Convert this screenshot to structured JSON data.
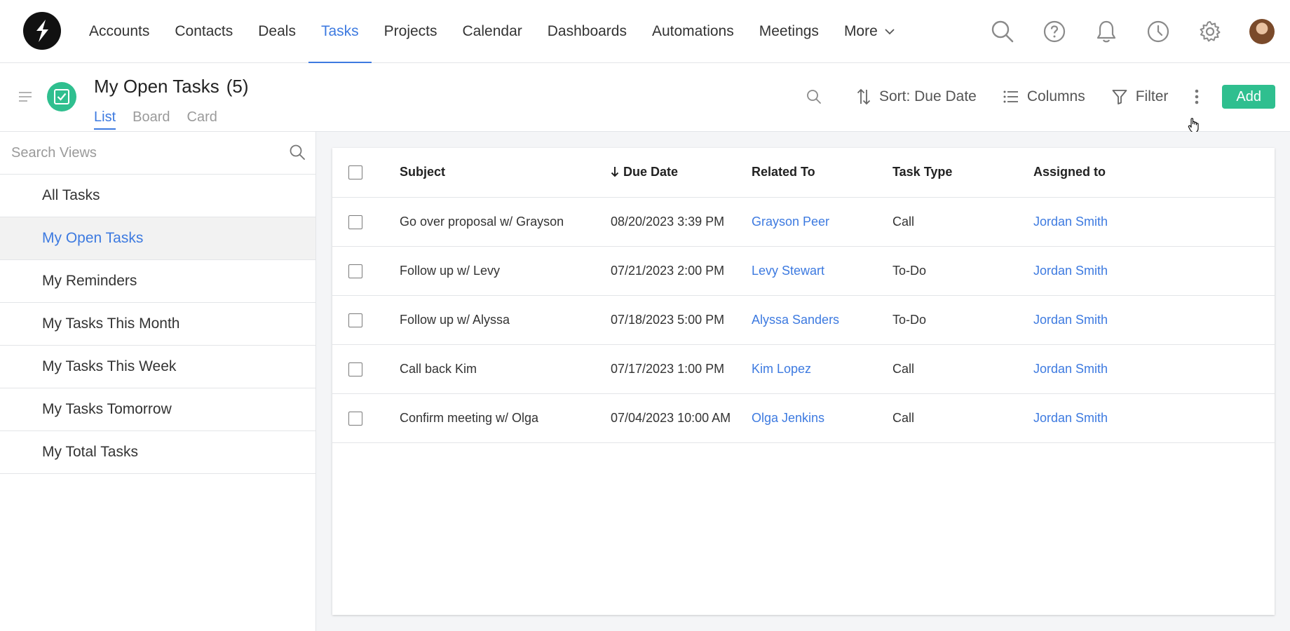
{
  "nav": {
    "items": [
      {
        "label": "Accounts",
        "active": false
      },
      {
        "label": "Contacts",
        "active": false
      },
      {
        "label": "Deals",
        "active": false
      },
      {
        "label": "Tasks",
        "active": true
      },
      {
        "label": "Projects",
        "active": false
      },
      {
        "label": "Calendar",
        "active": false
      },
      {
        "label": "Dashboards",
        "active": false
      },
      {
        "label": "Automations",
        "active": false
      },
      {
        "label": "Meetings",
        "active": false
      }
    ],
    "more_label": "More",
    "icons": [
      "search-icon",
      "help-icon",
      "bell-icon",
      "clock-icon",
      "gear-icon"
    ]
  },
  "header": {
    "title": "My Open Tasks",
    "count": "(5)",
    "tabs": [
      {
        "label": "List",
        "active": true
      },
      {
        "label": "Board",
        "active": false
      },
      {
        "label": "Card",
        "active": false
      }
    ],
    "toolbar": {
      "sort_label": "Sort: Due Date",
      "columns_label": "Columns",
      "filter_label": "Filter",
      "add_label": "Add"
    }
  },
  "sidebar": {
    "search_placeholder": "Search Views",
    "items": [
      {
        "label": "All Tasks",
        "active": false
      },
      {
        "label": "My Open Tasks",
        "active": true
      },
      {
        "label": "My Reminders",
        "active": false
      },
      {
        "label": "My Tasks This Month",
        "active": false
      },
      {
        "label": "My Tasks This Week",
        "active": false
      },
      {
        "label": "My Tasks Tomorrow",
        "active": false
      },
      {
        "label": "My Total Tasks",
        "active": false
      }
    ]
  },
  "table": {
    "columns": {
      "subject": "Subject",
      "due_date": "Due Date",
      "related_to": "Related To",
      "task_type": "Task Type",
      "assigned_to": "Assigned to"
    },
    "rows": [
      {
        "subject": "Go over proposal w/ Grayson",
        "due_date": "08/20/2023 3:39 PM",
        "related_to": "Grayson Peer",
        "task_type": "Call",
        "assigned_to": "Jordan Smith"
      },
      {
        "subject": "Follow up w/ Levy",
        "due_date": "07/21/2023 2:00 PM",
        "related_to": "Levy Stewart",
        "task_type": "To-Do",
        "assigned_to": "Jordan Smith"
      },
      {
        "subject": "Follow up w/ Alyssa",
        "due_date": "07/18/2023 5:00 PM",
        "related_to": "Alyssa Sanders",
        "task_type": "To-Do",
        "assigned_to": "Jordan Smith"
      },
      {
        "subject": "Call back Kim",
        "due_date": "07/17/2023 1:00 PM",
        "related_to": "Kim Lopez",
        "task_type": "Call",
        "assigned_to": "Jordan Smith"
      },
      {
        "subject": "Confirm meeting w/ Olga",
        "due_date": "07/04/2023 10:00 AM",
        "related_to": "Olga Jenkins",
        "task_type": "Call",
        "assigned_to": "Jordan Smith"
      }
    ]
  },
  "colors": {
    "accent": "#3d7ae0",
    "brand_green": "#2fbf8f",
    "border": "#e3e5e8",
    "content_bg": "#f4f5f7"
  }
}
